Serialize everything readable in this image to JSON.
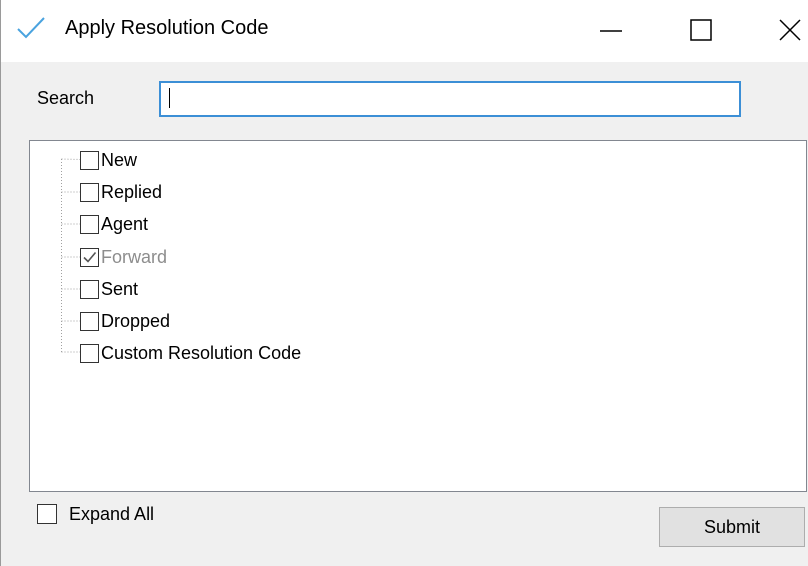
{
  "window": {
    "title": "Apply Resolution Code",
    "icon": "checkmark-icon",
    "controls": {
      "minimize": "minimize-icon",
      "maximize": "maximize-icon",
      "close": "close-icon"
    }
  },
  "search": {
    "label": "Search",
    "value": "",
    "placeholder": ""
  },
  "tree": {
    "items": [
      {
        "label": "New",
        "checked": false,
        "disabled": false
      },
      {
        "label": "Replied",
        "checked": false,
        "disabled": false
      },
      {
        "label": "Agent",
        "checked": false,
        "disabled": false
      },
      {
        "label": "Forward",
        "checked": true,
        "disabled": true
      },
      {
        "label": "Sent",
        "checked": false,
        "disabled": false
      },
      {
        "label": "Dropped",
        "checked": false,
        "disabled": false
      },
      {
        "label": "Custom Resolution Code",
        "checked": false,
        "disabled": false
      }
    ]
  },
  "expand_all": {
    "label": "Expand All",
    "checked": false
  },
  "submit": {
    "label": "Submit"
  },
  "colors": {
    "accent": "#3c8fd6",
    "icon": "#4aa3df",
    "disabled_text": "#8d8d8d",
    "button_bg": "#e1e1e1",
    "window_bg": "#f0f0f0"
  }
}
